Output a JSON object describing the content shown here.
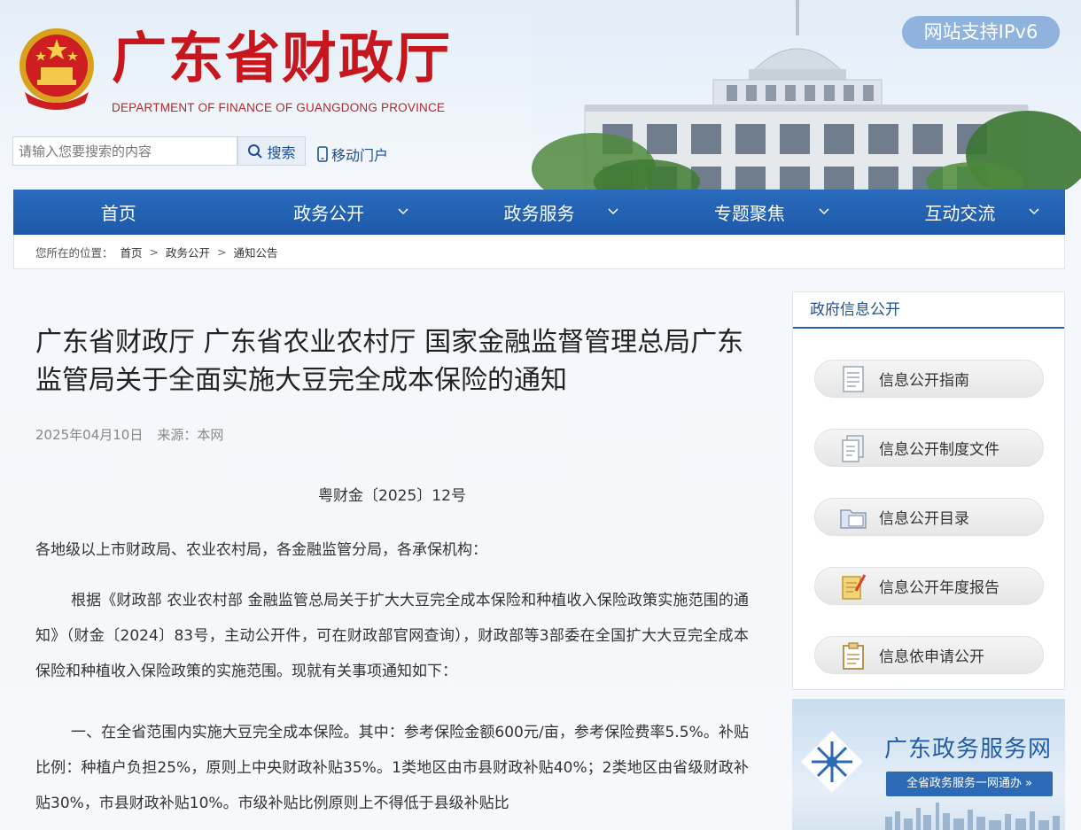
{
  "header": {
    "site_title": "广东省财政厅",
    "site_subtitle": "DEPARTMENT OF FINANCE OF GUANGDONG PROVINCE",
    "ipv6_badge": "网站支持IPv6",
    "search_placeholder": "请输入您要搜索的内容",
    "search_button": "搜索",
    "mobile_portal": "移动门户",
    "colors": {
      "title_red": "#c8161d",
      "nav_blue": "#1d59a9"
    }
  },
  "nav": {
    "items": [
      {
        "label": "首页"
      },
      {
        "label": "政务公开"
      },
      {
        "label": "政务服务"
      },
      {
        "label": "专题聚焦"
      },
      {
        "label": "互动交流"
      }
    ]
  },
  "breadcrumb": {
    "prefix": "您所在的位置：",
    "items": [
      "首页",
      "政务公开",
      "通知公告"
    ],
    "separator": ">"
  },
  "article": {
    "title": "广东省财政厅 广东省农业农村厅 国家金融监督管理总局广东监管局关于全面实施大豆完全成本保险的通知",
    "date": "2025年04月10日",
    "source": "来源：本网",
    "doc_no": "粤财金〔2025〕12号",
    "addressee": "各地级以上市财政局、农业农村局，各金融监管分局，各承保机构：",
    "paragraphs": [
      "根据《财政部 农业农村部 金融监管总局关于扩大大豆完全成本保险和种植收入保险政策实施范围的通知》（财金〔2024〕83号，主动公开件，可在财政部官网查询），财政部等3部委在全国扩大大豆完全成本保险和种植收入保险政策的实施范围。现就有关事项通知如下：",
      "一、在全省范围内实施大豆完全成本保险。其中：参考保险金额600元/亩，参考保险费率5.5%。补贴比例：种植户负担25%，原则上中央财政补贴35%。1类地区由市县财政补贴40%；2类地区由省级财政补贴30%，市县财政补贴10%。市级补贴比例原则上不得低于县级补贴比"
    ]
  },
  "sidebar": {
    "header": "政府信息公开",
    "buttons": [
      {
        "label": "信息公开指南",
        "icon": "document-icon"
      },
      {
        "label": "信息公开制度文件",
        "icon": "files-icon"
      },
      {
        "label": "信息公开目录",
        "icon": "folder-icon"
      },
      {
        "label": "信息公开年度报告",
        "icon": "pencil-note-icon"
      },
      {
        "label": "信息依申请公开",
        "icon": "clipboard-icon"
      }
    ],
    "banner": {
      "title": "广东政务服务网",
      "subtitle": "全省政务服务一网通办 »"
    }
  }
}
